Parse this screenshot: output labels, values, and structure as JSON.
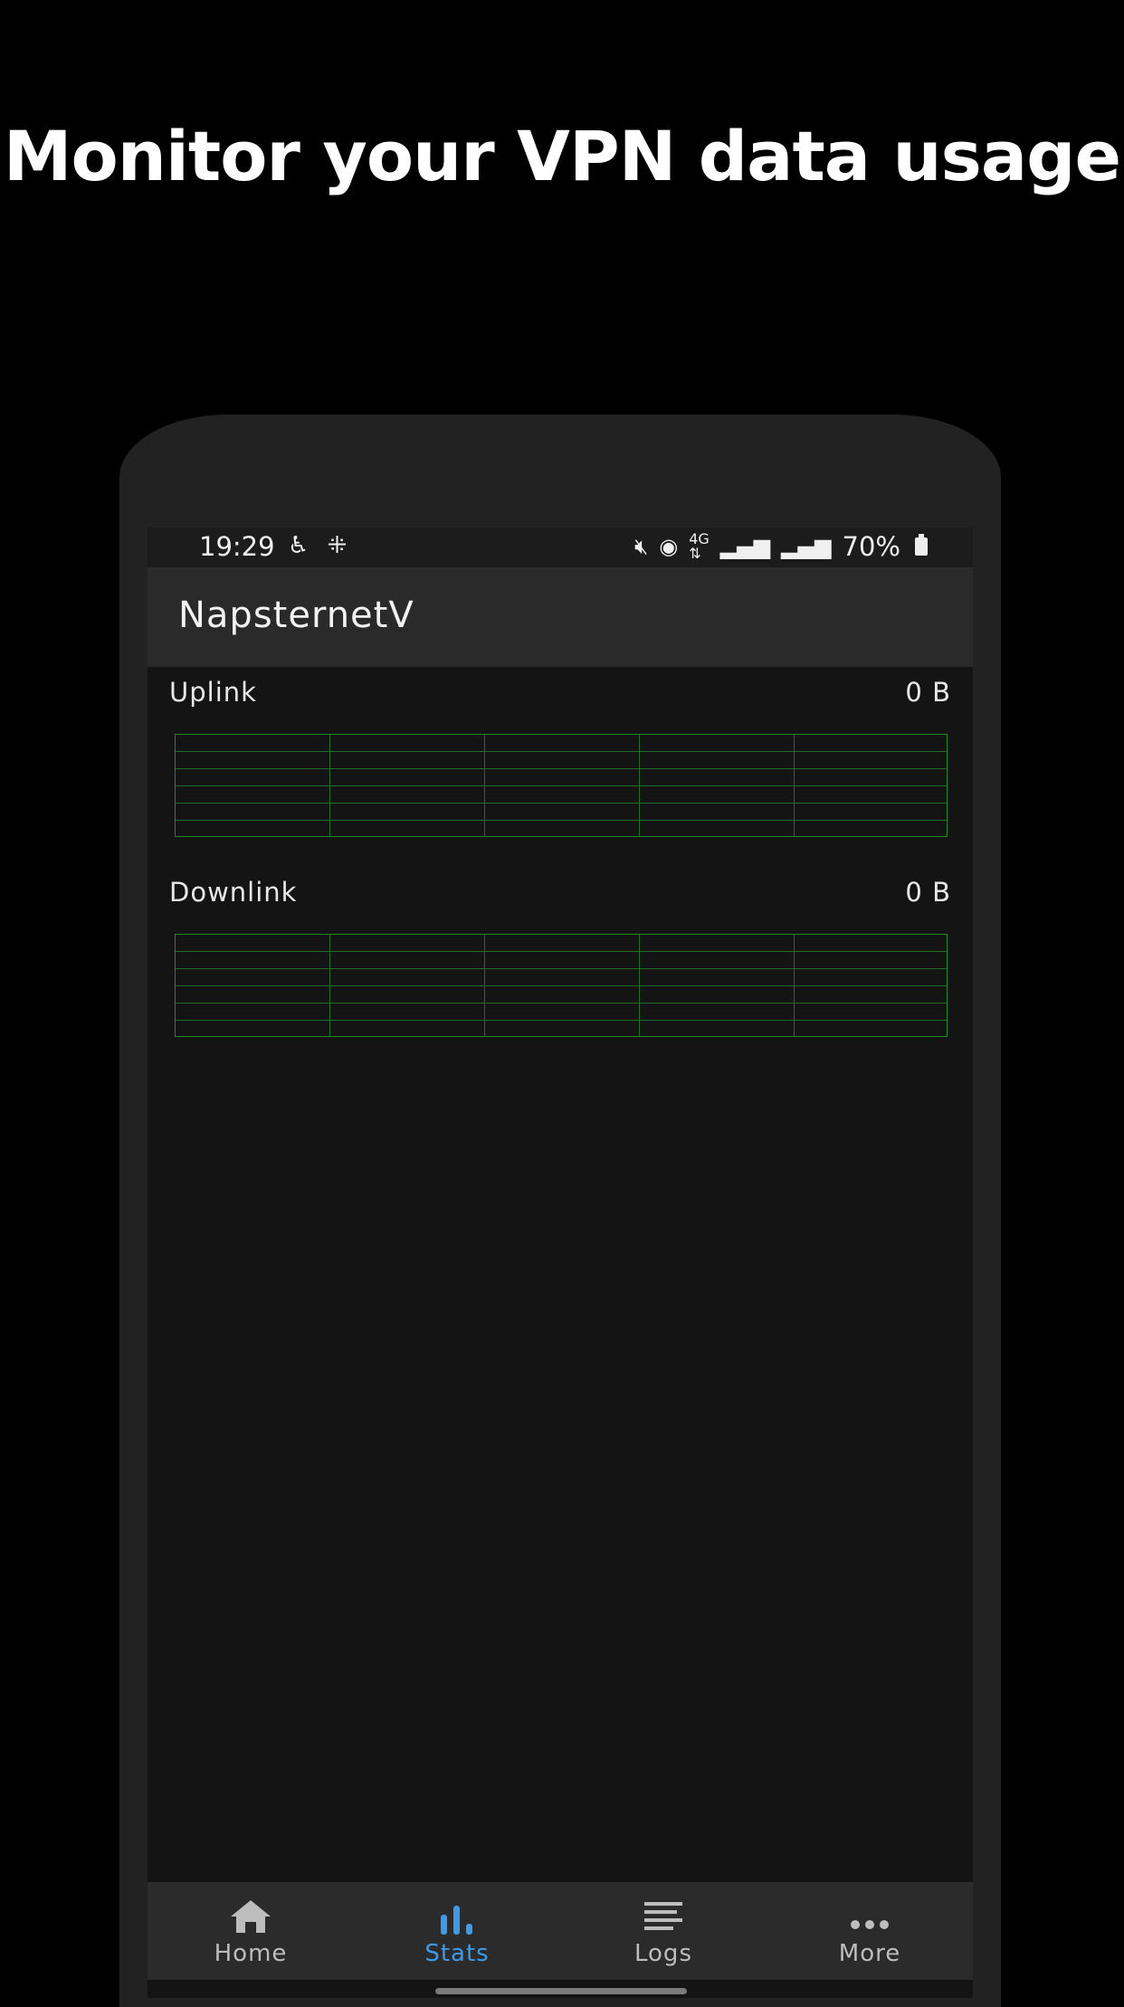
{
  "headline": "Monitor your VPN data usage",
  "status_bar": {
    "time": "19:29",
    "battery": "70%",
    "left_icons": [
      "accessibility-icon",
      "grid-icon"
    ],
    "right_icons": [
      "mute-icon",
      "hotspot-icon",
      "4g-icon",
      "signal-icon",
      "signal-icon",
      "battery-icon"
    ]
  },
  "app": {
    "title": "NapsternetV"
  },
  "stats": {
    "uplink": {
      "label": "Uplink",
      "value": "0 B"
    },
    "downlink": {
      "label": "Downlink",
      "value": "0 B"
    }
  },
  "nav": {
    "items": [
      {
        "label": "Home",
        "icon": "home-icon",
        "active": false
      },
      {
        "label": "Stats",
        "icon": "bar-chart-icon",
        "active": true
      },
      {
        "label": "Logs",
        "icon": "lines-icon",
        "active": false
      },
      {
        "label": "More",
        "icon": "more-icon",
        "active": false
      }
    ]
  },
  "colors": {
    "accent": "#3d9be9",
    "graph_line": "#1f8a2a",
    "background": "#141414"
  }
}
